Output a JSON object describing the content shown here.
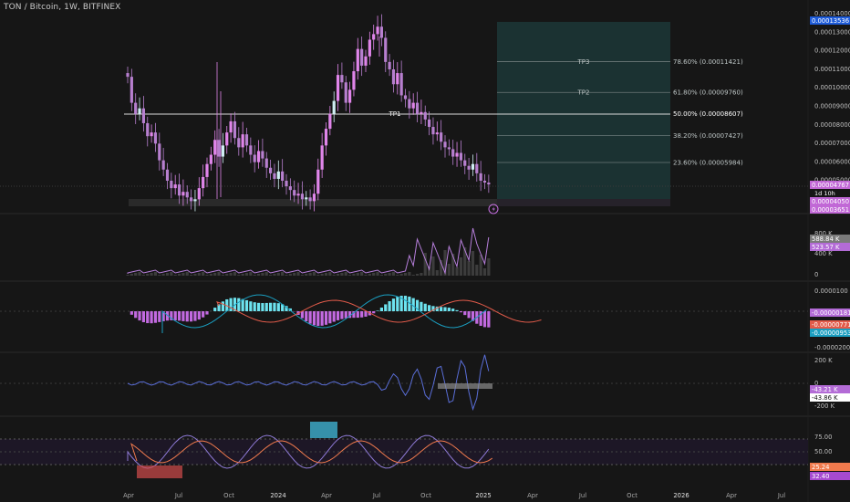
{
  "header": {
    "symbol_title": "TON / Bitcoin, 1W, BITFINEX"
  },
  "price_axis": {
    "ticks": [
      "0.00014000",
      "0.00013000",
      "0.00012000",
      "0.00011000",
      "0.00010000",
      "0.00009000",
      "0.00008000",
      "0.00007000",
      "0.00006000",
      "0.00005000"
    ],
    "badges": {
      "top": "0.00013536",
      "current": "0.00004767",
      "countdown": "1d 10h",
      "low1": "0.00004050",
      "low2": "0.00003651"
    }
  },
  "fib_levels": [
    {
      "label": "78.60% (0.00011421)",
      "price": 0.00011421,
      "tp": "TP3"
    },
    {
      "label": "61.80% (0.00009760)",
      "price": 9.76e-05,
      "tp": "TP2"
    },
    {
      "label": "50.00% (0.00008607)",
      "price": 8.607e-05,
      "tp": "TP1"
    },
    {
      "label": "38.20% (0.00007427)",
      "price": 7.427e-05,
      "tp": ""
    },
    {
      "label": "23.60% (0.00005984)",
      "price": 5.984e-05,
      "tp": ""
    }
  ],
  "volume_pane": {
    "ticks": [
      "800 K",
      "400 K",
      "0"
    ],
    "badges": [
      "588.84 K",
      "523.57 K"
    ]
  },
  "macd_pane": {
    "ticks": [
      "0.0000100",
      "-0.0000200"
    ],
    "badges": [
      "-0.00000181",
      "-0.00000771",
      "-0.00000953"
    ]
  },
  "osc_pane": {
    "ticks": [
      "200 K",
      "0",
      "-200 K"
    ],
    "badges": [
      "-43.21 K",
      "-43.86 K"
    ]
  },
  "rsi_pane": {
    "ticks": [
      "75.00",
      "50.00",
      "25.00"
    ],
    "badges": [
      "25.24",
      "32.40"
    ]
  },
  "time_axis": {
    "labels": [
      "Apr",
      "Jul",
      "Oct",
      "2024",
      "Apr",
      "Jul",
      "Oct",
      "2025",
      "Apr",
      "Jul",
      "Oct",
      "2026",
      "Apr",
      "Jul"
    ]
  },
  "colors": {
    "background": "#161616",
    "up_candle": "#e085ea",
    "down_candle": "#b77fcf",
    "mint_candle": "#cfeff3",
    "accent_top": "#1e5bd8",
    "current_badge": "#c168d6",
    "target_zone": "#1b3434",
    "macd_orange": "#e25b4a",
    "macd_blue": "#1a9ec0",
    "rsi_orange": "#f07a4d",
    "rsi_bubble": "#a64ad0"
  }
}
